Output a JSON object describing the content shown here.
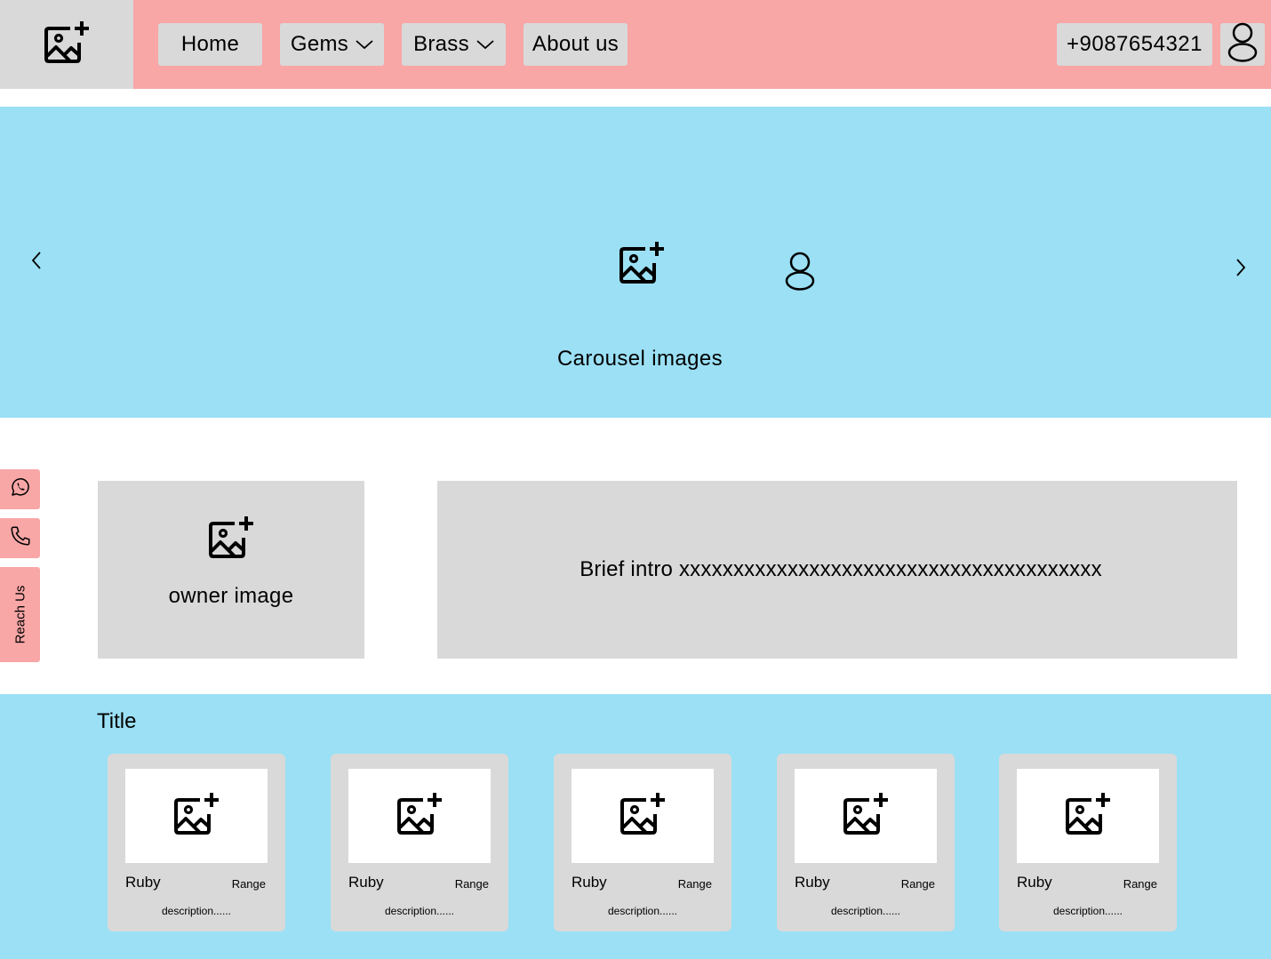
{
  "header": {
    "logo_icon": "add-image-icon",
    "nav": [
      {
        "label": "Home",
        "dropdown": false
      },
      {
        "label": "Gems",
        "dropdown": true
      },
      {
        "label": "Brass",
        "dropdown": true
      },
      {
        "label": "About us",
        "dropdown": false
      }
    ],
    "phone": "+9087654321",
    "profile_icon": "user-icon"
  },
  "carousel": {
    "caption": "Carousel images",
    "prev_icon": "chevron-left-icon",
    "next_icon": "chevron-right-icon"
  },
  "side_tabs": {
    "whatsapp_icon": "whatsapp-icon",
    "phone_icon": "phone-icon",
    "reach_label": "Reach Us"
  },
  "intro": {
    "owner_caption": "owner image",
    "brief": "Brief intro xxxxxxxxxxxxxxxxxxxxxxxxxxxxxxxxxxxxxxx"
  },
  "products": {
    "title": "Title",
    "cards": [
      {
        "name": "Ruby",
        "range": "Range",
        "description": "description......"
      },
      {
        "name": "Ruby",
        "range": "Range",
        "description": "description......"
      },
      {
        "name": "Ruby",
        "range": "Range",
        "description": "description......"
      },
      {
        "name": "Ruby",
        "range": "Range",
        "description": "description......"
      },
      {
        "name": "Ruby",
        "range": "Range",
        "description": "description......"
      }
    ]
  },
  "colors": {
    "header_bg": "#f8a6a6",
    "section_bg": "#9be0f5",
    "placeholder_bg": "#d9d9d9"
  }
}
